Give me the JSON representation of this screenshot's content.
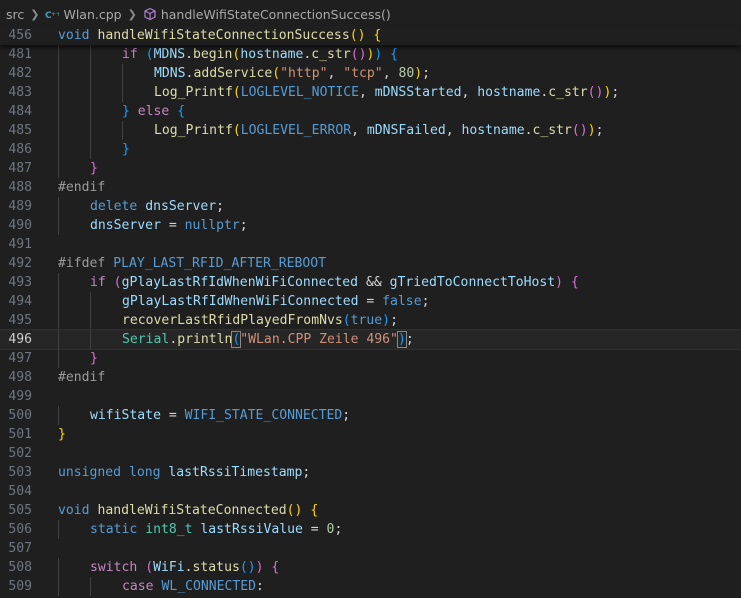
{
  "breadcrumb": {
    "root": "src",
    "file": "Wlan.cpp",
    "symbol": "handleWifiStateConnectionSuccess()"
  },
  "sticky": {
    "number": "456",
    "tokens": [
      [
        "kw",
        "void"
      ],
      [
        "plain",
        " "
      ],
      [
        "fn",
        "handleWifiStateConnectionSuccess"
      ],
      [
        "b1",
        "()"
      ],
      [
        "plain",
        " "
      ],
      [
        "b1",
        "{"
      ]
    ]
  },
  "lines": [
    {
      "n": "481",
      "indent": 2,
      "tokens": [
        [
          "ctl",
          "if"
        ],
        [
          "plain",
          " "
        ],
        [
          "b3",
          "("
        ],
        [
          "var",
          "MDNS"
        ],
        [
          "plain",
          "."
        ],
        [
          "fn",
          "begin"
        ],
        [
          "b1",
          "("
        ],
        [
          "var",
          "hostname"
        ],
        [
          "plain",
          "."
        ],
        [
          "fn",
          "c_str"
        ],
        [
          "b2",
          "()"
        ],
        [
          "b1",
          ")"
        ],
        [
          "b3",
          ")"
        ],
        [
          "plain",
          " "
        ],
        [
          "b3",
          "{"
        ]
      ]
    },
    {
      "n": "482",
      "indent": 3,
      "tokens": [
        [
          "var",
          "MDNS"
        ],
        [
          "plain",
          "."
        ],
        [
          "fn",
          "addService"
        ],
        [
          "b1",
          "("
        ],
        [
          "str",
          "\"http\""
        ],
        [
          "plain",
          ", "
        ],
        [
          "str",
          "\"tcp\""
        ],
        [
          "plain",
          ", "
        ],
        [
          "num",
          "80"
        ],
        [
          "b1",
          ")"
        ],
        [
          "plain",
          ";"
        ]
      ]
    },
    {
      "n": "483",
      "indent": 3,
      "tokens": [
        [
          "fn",
          "Log_Printf"
        ],
        [
          "b1",
          "("
        ],
        [
          "mac",
          "LOGLEVEL_NOTICE"
        ],
        [
          "plain",
          ", "
        ],
        [
          "var",
          "mDNSStarted"
        ],
        [
          "plain",
          ", "
        ],
        [
          "var",
          "hostname"
        ],
        [
          "plain",
          "."
        ],
        [
          "fn",
          "c_str"
        ],
        [
          "b2",
          "()"
        ],
        [
          "b1",
          ")"
        ],
        [
          "plain",
          ";"
        ]
      ]
    },
    {
      "n": "484",
      "indent": 2,
      "tokens": [
        [
          "b3",
          "}"
        ],
        [
          "plain",
          " "
        ],
        [
          "ctl",
          "else"
        ],
        [
          "plain",
          " "
        ],
        [
          "b3",
          "{"
        ]
      ]
    },
    {
      "n": "485",
      "indent": 3,
      "tokens": [
        [
          "fn",
          "Log_Printf"
        ],
        [
          "b1",
          "("
        ],
        [
          "mac",
          "LOGLEVEL_ERROR"
        ],
        [
          "plain",
          ", "
        ],
        [
          "var",
          "mDNSFailed"
        ],
        [
          "plain",
          ", "
        ],
        [
          "var",
          "hostname"
        ],
        [
          "plain",
          "."
        ],
        [
          "fn",
          "c_str"
        ],
        [
          "b2",
          "()"
        ],
        [
          "b1",
          ")"
        ],
        [
          "plain",
          ";"
        ]
      ]
    },
    {
      "n": "486",
      "indent": 2,
      "tokens": [
        [
          "b3",
          "}"
        ]
      ]
    },
    {
      "n": "487",
      "indent": 1,
      "tokens": [
        [
          "b2",
          "}"
        ]
      ]
    },
    {
      "n": "488",
      "indent": 0,
      "tokens": [
        [
          "pp",
          "#endif"
        ]
      ]
    },
    {
      "n": "489",
      "indent": 1,
      "tokens": [
        [
          "kw",
          "delete"
        ],
        [
          "plain",
          " "
        ],
        [
          "var",
          "dnsServer"
        ],
        [
          "plain",
          ";"
        ]
      ]
    },
    {
      "n": "490",
      "indent": 1,
      "tokens": [
        [
          "var",
          "dnsServer"
        ],
        [
          "plain",
          " = "
        ],
        [
          "kw",
          "nullptr"
        ],
        [
          "plain",
          ";"
        ]
      ]
    },
    {
      "n": "491",
      "indent": 0,
      "tokens": []
    },
    {
      "n": "492",
      "indent": 0,
      "tokens": [
        [
          "pp",
          "#ifdef"
        ],
        [
          "plain",
          " "
        ],
        [
          "mac",
          "PLAY_LAST_RFID_AFTER_REBOOT"
        ]
      ]
    },
    {
      "n": "493",
      "indent": 1,
      "tokens": [
        [
          "ctl",
          "if"
        ],
        [
          "plain",
          " "
        ],
        [
          "b2",
          "("
        ],
        [
          "var",
          "gPlayLastRfIdWhenWiFiConnected"
        ],
        [
          "plain",
          " && "
        ],
        [
          "var",
          "gTriedToConnectToHost"
        ],
        [
          "b2",
          ")"
        ],
        [
          "plain",
          " "
        ],
        [
          "b2",
          "{"
        ]
      ]
    },
    {
      "n": "494",
      "indent": 2,
      "tokens": [
        [
          "var",
          "gPlayLastRfIdWhenWiFiConnected"
        ],
        [
          "plain",
          " = "
        ],
        [
          "kw",
          "false"
        ],
        [
          "plain",
          ";"
        ]
      ]
    },
    {
      "n": "495",
      "indent": 2,
      "tokens": [
        [
          "fn",
          "recoverLastRfidPlayedFromNvs"
        ],
        [
          "b3",
          "("
        ],
        [
          "kw",
          "true"
        ],
        [
          "b3",
          ")"
        ],
        [
          "plain",
          ";"
        ]
      ]
    },
    {
      "n": "496",
      "indent": 2,
      "current": true,
      "tokens": [
        [
          "typ",
          "Serial"
        ],
        [
          "plain",
          "."
        ],
        [
          "fn",
          "println"
        ],
        [
          "b3bm",
          "("
        ],
        [
          "str",
          "\"WLan.CPP Zeile 496\""
        ],
        [
          "b3bm",
          ")"
        ],
        [
          "plain",
          ";"
        ]
      ]
    },
    {
      "n": "497",
      "indent": 1,
      "tokens": [
        [
          "b2",
          "}"
        ]
      ]
    },
    {
      "n": "498",
      "indent": 0,
      "tokens": [
        [
          "pp",
          "#endif"
        ]
      ]
    },
    {
      "n": "499",
      "indent": 0,
      "tokens": []
    },
    {
      "n": "500",
      "indent": 1,
      "tokens": [
        [
          "var",
          "wifiState"
        ],
        [
          "plain",
          " = "
        ],
        [
          "mac",
          "WIFI_STATE_CONNECTED"
        ],
        [
          "plain",
          ";"
        ]
      ]
    },
    {
      "n": "501",
      "indent": 0,
      "tokens": [
        [
          "b1",
          "}"
        ]
      ]
    },
    {
      "n": "502",
      "indent": 0,
      "tokens": []
    },
    {
      "n": "503",
      "indent": 0,
      "tokens": [
        [
          "kw",
          "unsigned"
        ],
        [
          "plain",
          " "
        ],
        [
          "kw",
          "long"
        ],
        [
          "plain",
          " "
        ],
        [
          "var",
          "lastRssiTimestamp"
        ],
        [
          "plain",
          ";"
        ]
      ]
    },
    {
      "n": "504",
      "indent": 0,
      "tokens": []
    },
    {
      "n": "505",
      "indent": 0,
      "tokens": [
        [
          "kw",
          "void"
        ],
        [
          "plain",
          " "
        ],
        [
          "fn",
          "handleWifiStateConnected"
        ],
        [
          "b1",
          "()"
        ],
        [
          "plain",
          " "
        ],
        [
          "b1",
          "{"
        ]
      ]
    },
    {
      "n": "506",
      "indent": 1,
      "tokens": [
        [
          "kw",
          "static"
        ],
        [
          "plain",
          " "
        ],
        [
          "typ",
          "int8_t"
        ],
        [
          "plain",
          " "
        ],
        [
          "var",
          "lastRssiValue"
        ],
        [
          "plain",
          " = "
        ],
        [
          "num",
          "0"
        ],
        [
          "plain",
          ";"
        ]
      ]
    },
    {
      "n": "507",
      "indent": 0,
      "tokens": []
    },
    {
      "n": "508",
      "indent": 1,
      "tokens": [
        [
          "ctl",
          "switch"
        ],
        [
          "plain",
          " "
        ],
        [
          "b2",
          "("
        ],
        [
          "var",
          "WiFi"
        ],
        [
          "plain",
          "."
        ],
        [
          "fn",
          "status"
        ],
        [
          "b3",
          "()"
        ],
        [
          "b2",
          ")"
        ],
        [
          "plain",
          " "
        ],
        [
          "b2",
          "{"
        ]
      ]
    },
    {
      "n": "509",
      "indent": 2,
      "tokens": [
        [
          "ctl",
          "case"
        ],
        [
          "plain",
          " "
        ],
        [
          "mac",
          "WL_CONNECTED"
        ],
        [
          "plain",
          ":"
        ]
      ]
    }
  ]
}
